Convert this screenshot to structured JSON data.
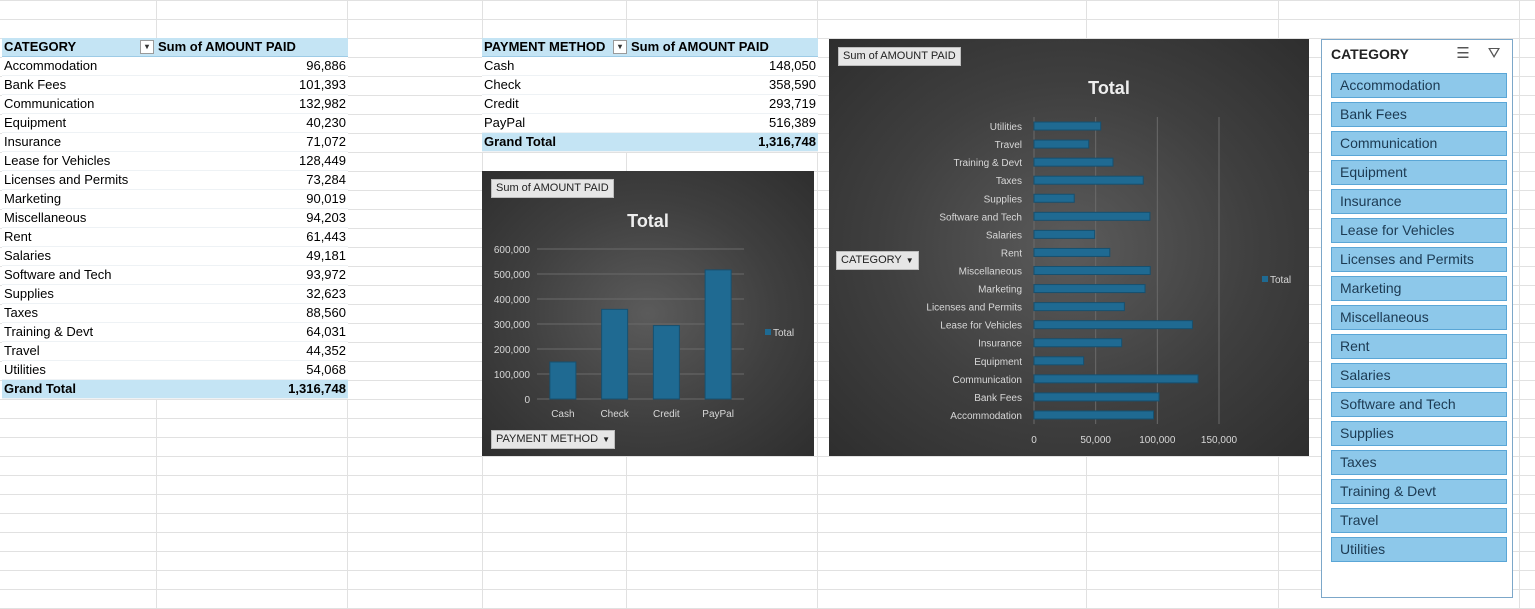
{
  "category_pivot": {
    "header_category": "CATEGORY",
    "header_sum": "Sum of AMOUNT PAID",
    "rows": [
      {
        "label": "Accommodation",
        "value": "96,886"
      },
      {
        "label": "Bank Fees",
        "value": "101,393"
      },
      {
        "label": "Communication",
        "value": "132,982"
      },
      {
        "label": "Equipment",
        "value": "40,230"
      },
      {
        "label": "Insurance",
        "value": "71,072"
      },
      {
        "label": "Lease for Vehicles",
        "value": "128,449"
      },
      {
        "label": "Licenses and Permits",
        "value": "73,284"
      },
      {
        "label": "Marketing",
        "value": "90,019"
      },
      {
        "label": "Miscellaneous",
        "value": "94,203"
      },
      {
        "label": "Rent",
        "value": "61,443"
      },
      {
        "label": "Salaries",
        "value": "49,181"
      },
      {
        "label": "Software and Tech",
        "value": "93,972"
      },
      {
        "label": "Supplies",
        "value": "32,623"
      },
      {
        "label": "Taxes",
        "value": "88,560"
      },
      {
        "label": "Training & Devt",
        "value": "64,031"
      },
      {
        "label": "Travel",
        "value": "44,352"
      },
      {
        "label": "Utilities",
        "value": "54,068"
      }
    ],
    "grand_total_label": "Grand Total",
    "grand_total_value": "1,316,748"
  },
  "payment_pivot": {
    "header_method": "PAYMENT METHOD",
    "header_sum": "Sum of AMOUNT PAID",
    "rows": [
      {
        "label": "Cash",
        "value": "148,050"
      },
      {
        "label": "Check",
        "value": "358,590"
      },
      {
        "label": "Credit",
        "value": "293,719"
      },
      {
        "label": "PayPal",
        "value": "516,389"
      }
    ],
    "grand_total_label": "Grand Total",
    "grand_total_value": "1,316,748"
  },
  "payment_chart_ui": {
    "field_button": "Sum of AMOUNT PAID",
    "axis_button": "PAYMENT METHOD"
  },
  "category_chart_ui": {
    "field_button": "Sum of AMOUNT PAID",
    "axis_button": "CATEGORY"
  },
  "chart_data": [
    {
      "type": "bar",
      "title": "Total",
      "categories": [
        "Cash",
        "Check",
        "Credit",
        "PayPal"
      ],
      "series": [
        {
          "name": "Total",
          "values": [
            148050,
            358590,
            293719,
            516389
          ]
        }
      ],
      "ylim": [
        0,
        600000
      ],
      "yticks": [
        "0",
        "100,000",
        "200,000",
        "300,000",
        "400,000",
        "500,000",
        "600,000"
      ],
      "grid": true,
      "legend": "right",
      "bar_color": "#1f6a92"
    },
    {
      "type": "bar",
      "orientation": "horizontal",
      "title": "Total",
      "categories": [
        "Accommodation",
        "Bank Fees",
        "Communication",
        "Equipment",
        "Insurance",
        "Lease for Vehicles",
        "Licenses and Permits",
        "Marketing",
        "Miscellaneous",
        "Rent",
        "Salaries",
        "Software and Tech",
        "Supplies",
        "Taxes",
        "Training & Devt",
        "Travel",
        "Utilities"
      ],
      "series": [
        {
          "name": "Total",
          "values": [
            96886,
            101393,
            132982,
            40230,
            71072,
            128449,
            73284,
            90019,
            94203,
            61443,
            49181,
            93972,
            32623,
            88560,
            64031,
            44352,
            54068
          ]
        }
      ],
      "xlim": [
        0,
        150000
      ],
      "xticks": [
        "0",
        "50,000",
        "100,000",
        "150,000"
      ],
      "grid": true,
      "legend": "right",
      "bar_color": "#1f6a92"
    }
  ],
  "slicer": {
    "title": "CATEGORY",
    "icons": [
      "multi-select-icon",
      "clear-filter-icon"
    ],
    "items": [
      "Accommodation",
      "Bank Fees",
      "Communication",
      "Equipment",
      "Insurance",
      "Lease for Vehicles",
      "Licenses and Permits",
      "Marketing",
      "Miscellaneous",
      "Rent",
      "Salaries",
      "Software and Tech",
      "Supplies",
      "Taxes",
      "Training & Devt",
      "Travel",
      "Utilities"
    ],
    "colors": {
      "item_bg": "#8dc8ea",
      "item_border": "#5aa6d6"
    }
  }
}
